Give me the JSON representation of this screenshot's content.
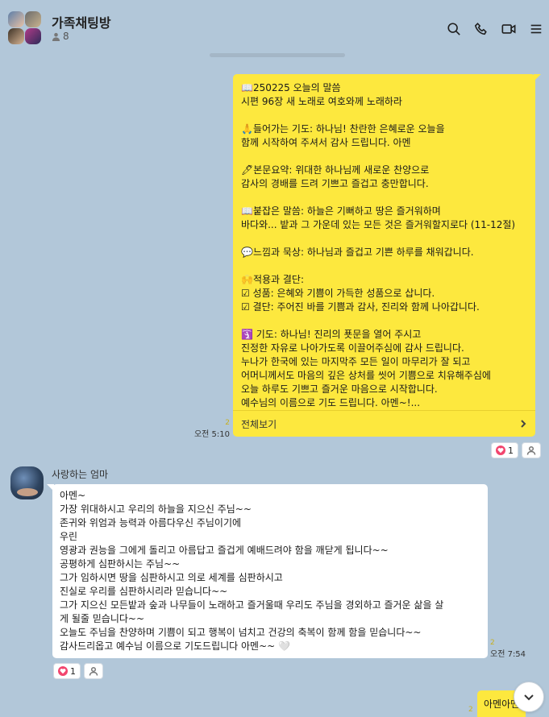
{
  "header": {
    "title": "가족채팅방",
    "member_count": "8"
  },
  "my_message": {
    "text": "📖250225 오늘의 말씀\n시편 96장 새 노래로 여호와께 노래하라\n\n🙏들어가는 기도: 하나님! 찬란한 은혜로운 오늘을\n함께 시작하여 주셔서 감사 드립니다. 아멘\n\n🖊본문요약: 위대한 하나님께 새로운 찬양으로\n감사의 경배를 드려 기쁘고 즐겁고 충만합니다.\n\n📖붙잡은 말씀: 하늘은 기뻐하고 땅은 즐거워하며\n바다와... 밭과 그 가운데 있는 모든 것은 즐거워할지로다 (11-12절)\n\n💬느낌과 묵상: 하나님과 즐겁고 기쁜 하루를 채워갑니다.\n\n🙌적용과 결단:\n☑ 성품: 은혜와 기쁨이 가득한 성품으로 삽니다.\n☑ 결단: 주어진 바를 기쁨과 감사, 진리와 함께 나아갑니다.\n\n🛐 기도: 하나님! 진리의 푯문을 열어 주시고\n진정한 자유로 나아가도록 이끌어주심에 감사 드립니다.\n누나가 한국에 있는 마지막주 모든 일이 마무리가 잘 되고\n어머니께서도 마음의 깊은 상처를 씻어 기쁨으로 치유해주심에\n오늘 하루도 기쁘고 즐거운 마음으로 시작합니다.\n예수님의 이름으로 기도 드립니다.  아멘~!...",
    "see_all": "전체보기",
    "unread": "2",
    "time": "오전 5:10",
    "reaction_count": "1"
  },
  "mom_message": {
    "sender": "사랑하는 엄마",
    "text": "아멘~\n가장 위대하시고 우리의 하늘을 지으신 주님~~\n존귀와 위엄과 능력과 아름다우신 주님이기에\n우린\n영광과 권능을 그에게 돌리고 아름답고 즐겁게 예배드려야 함을 깨닫게 됩니다~~\n공평하게 심판하시는 주님~~\n그가 임하시면 땅을 심판하시고 의로 세계를 심판하시고\n진실로 우리를 심판하시리라 믿습니다~~\n그가 지으신 모든밭과 숲과 나무들이 노래하고 즐거울때 우리도 주님을 경외하고 즐거운 삶을 살\n게 될줄 믿습니다~~\n오늘도 주님을 찬양하며 기쁨이 되고 행복이 넘치고 건강의 축복이 함께 함을 믿습니다~~\n감사드리옵고 예수님 이름으로 기도드립니다 아멘~~ 🤍",
    "unread": "2",
    "time": "오전 7:54",
    "reaction_count": "1"
  },
  "last_message": {
    "text": "아멘아멘",
    "unread": "2"
  },
  "colors": {
    "background": "#b2c7d9",
    "my_bubble": "#fde83e",
    "other_bubble": "#ffffff",
    "heart": "#f2456e"
  },
  "icons": [
    "search-icon",
    "phone-icon",
    "video-call-icon",
    "menu-icon",
    "person-icon",
    "heart-icon",
    "chevron-right-icon",
    "chevron-down-icon"
  ]
}
